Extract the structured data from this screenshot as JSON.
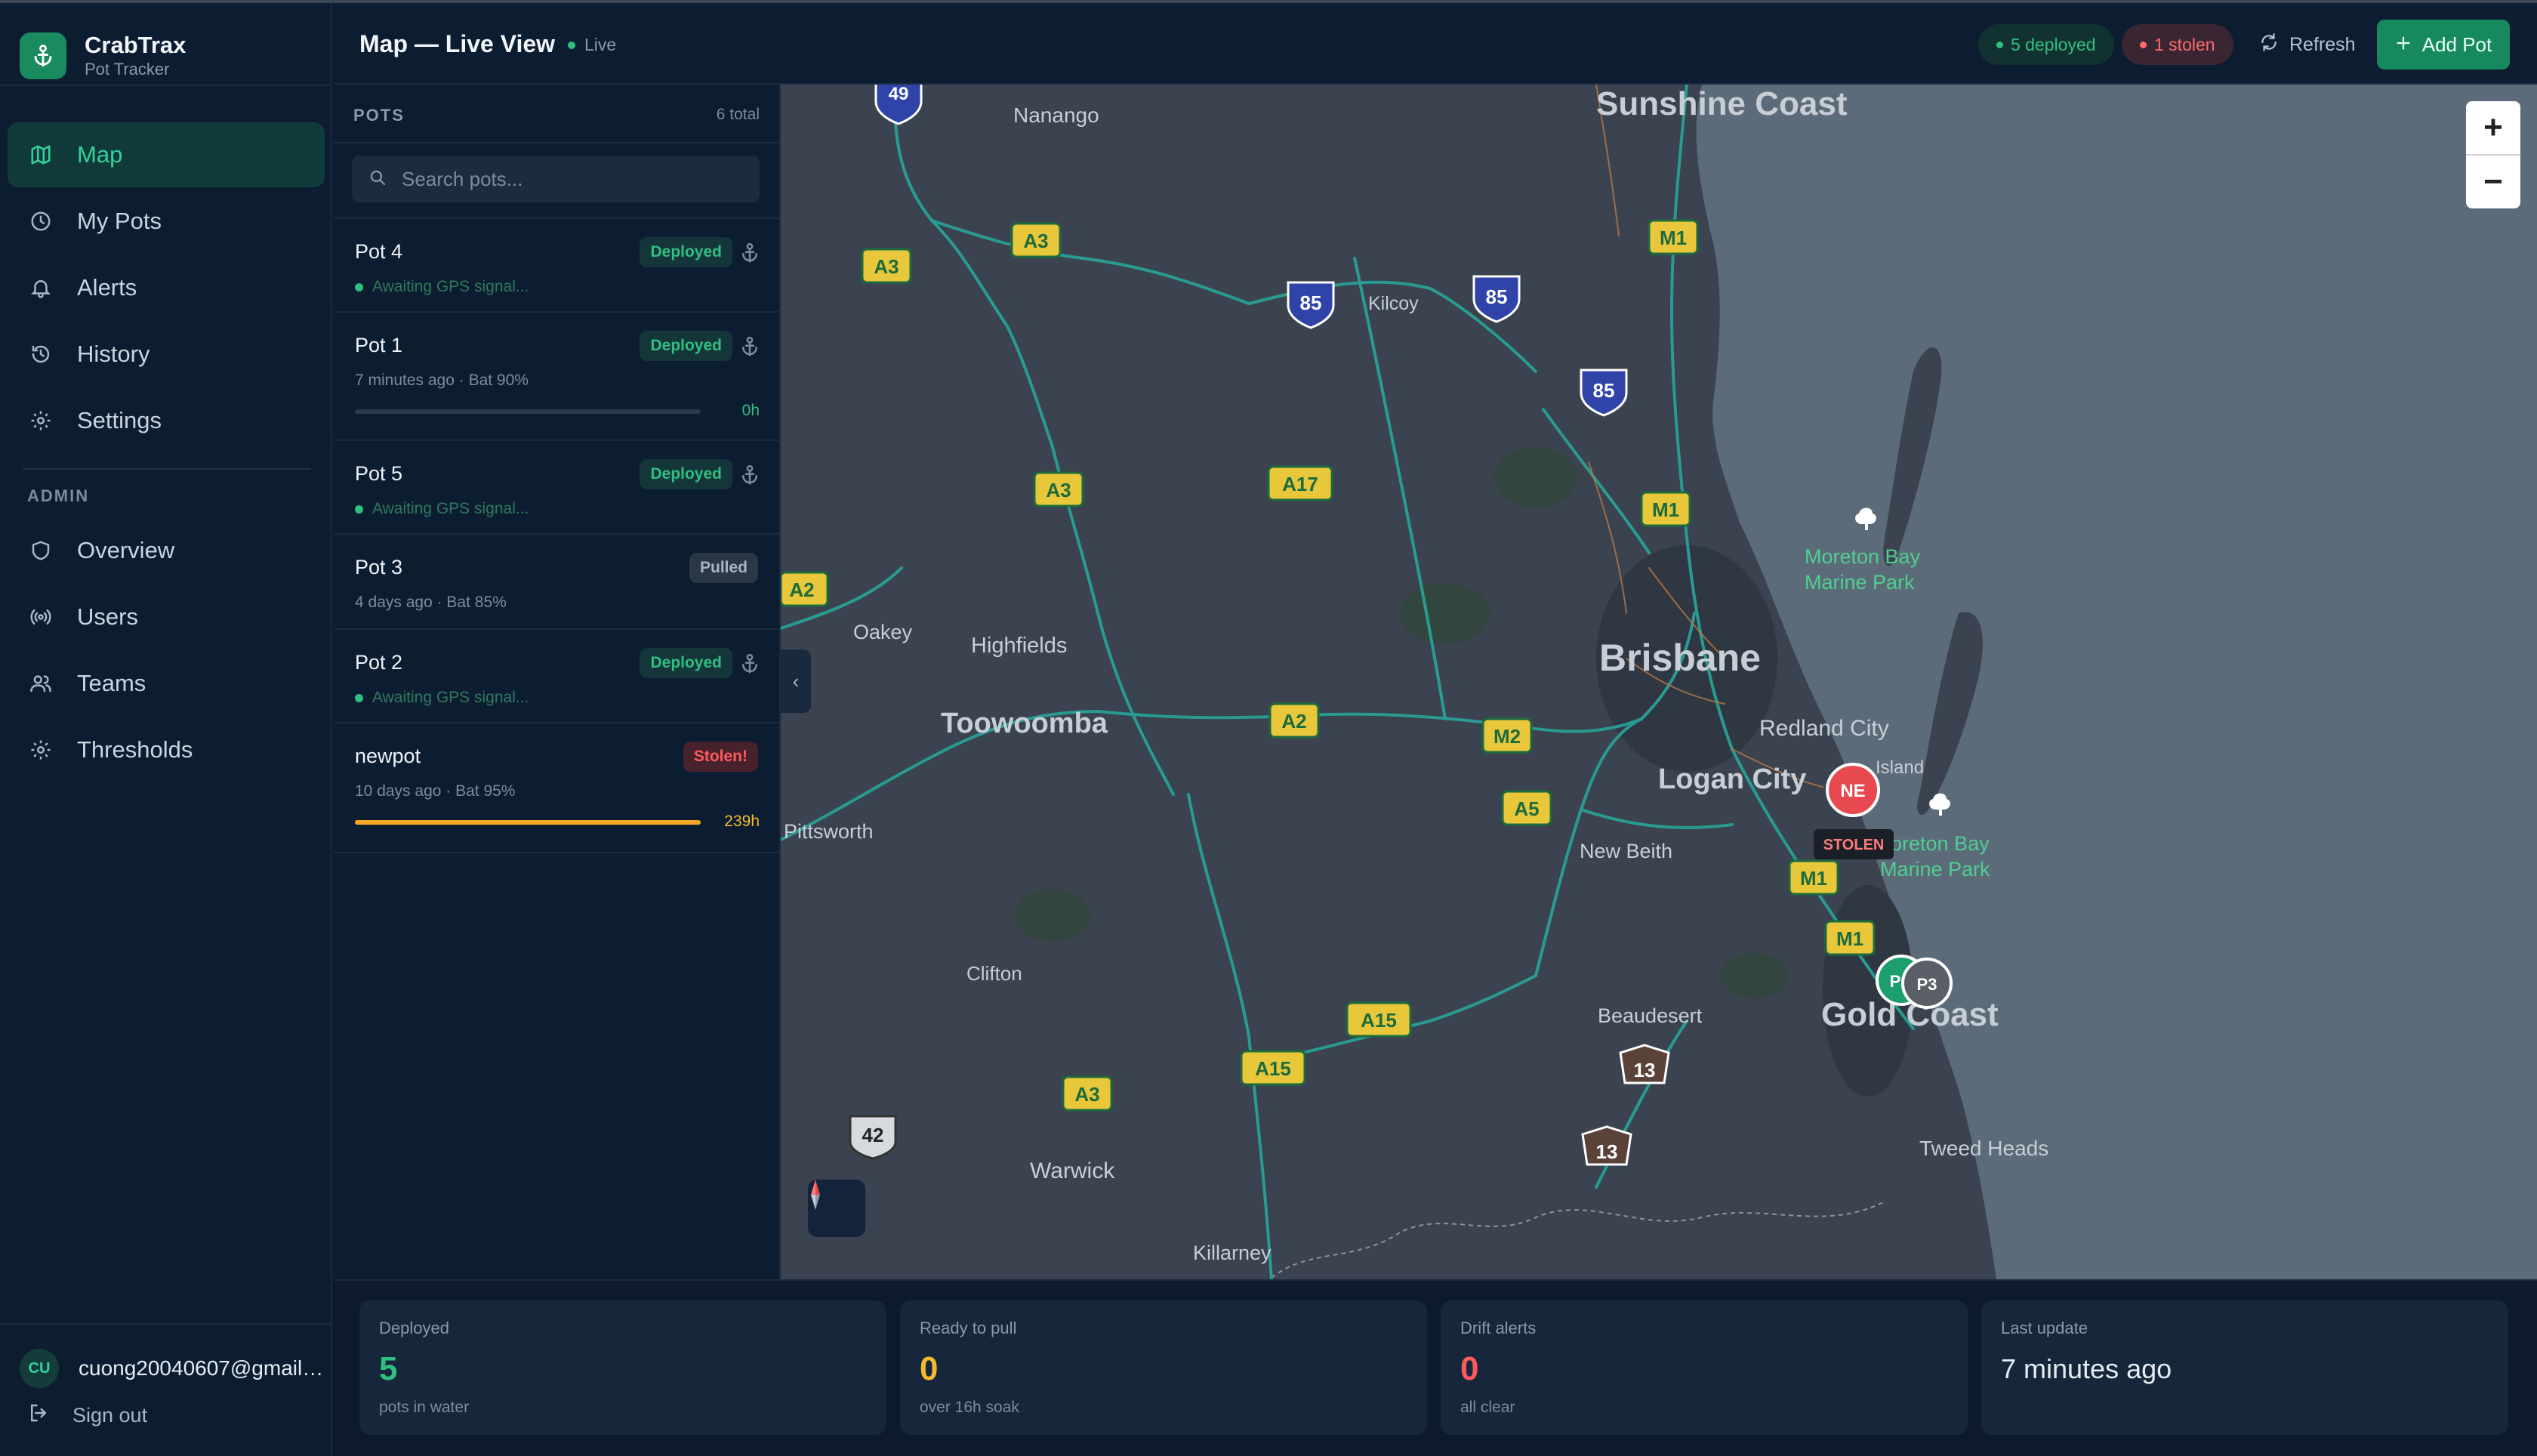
{
  "app": {
    "name": "CrabTrax",
    "subtitle": "Pot Tracker"
  },
  "sidebar": {
    "items": [
      {
        "label": "Map",
        "icon": "map-icon",
        "active": true
      },
      {
        "label": "My Pots",
        "icon": "clock-icon"
      },
      {
        "label": "Alerts",
        "icon": "bell-icon"
      },
      {
        "label": "History",
        "icon": "history-icon"
      },
      {
        "label": "Settings",
        "icon": "gear-icon"
      }
    ],
    "admin_heading": "ADMIN",
    "admin_items": [
      {
        "label": "Overview",
        "icon": "shield-icon"
      },
      {
        "label": "Users",
        "icon": "broadcast-icon"
      },
      {
        "label": "Teams",
        "icon": "users-icon"
      },
      {
        "label": "Thresholds",
        "icon": "gear-icon"
      }
    ],
    "user": {
      "initials": "CU",
      "email": "cuong20040607@gmail…"
    },
    "signout_label": "Sign out"
  },
  "header": {
    "title": "Map — Live View",
    "live_label": "Live",
    "deployed_pill": "5 deployed",
    "stolen_pill": "1 stolen",
    "refresh_label": "Refresh",
    "add_label": "Add Pot"
  },
  "pots": {
    "heading": "POTS",
    "count": "6 total",
    "search_placeholder": "Search pots...",
    "list": [
      {
        "name": "Pot 4",
        "badge": "Deployed",
        "sub": "Awaiting GPS signal..."
      },
      {
        "name": "Pot 1",
        "badge": "Deployed",
        "sub": "7 minutes ago · Bat 90%",
        "bar_value": "0h",
        "bar_fraction": 0
      },
      {
        "name": "Pot 5",
        "badge": "Deployed",
        "sub": "Awaiting GPS signal..."
      },
      {
        "name": "Pot 3",
        "badge": "Pulled",
        "sub": "4 days ago · Bat 85%"
      },
      {
        "name": "Pot 2",
        "badge": "Deployed",
        "sub": "Awaiting GPS signal..."
      },
      {
        "name": "newpot",
        "badge": "Stolen!",
        "sub": "10 days ago · Bat 95%",
        "bar_value": "239h",
        "bar_fraction": 1
      }
    ]
  },
  "map": {
    "places": {
      "sunshine_coast": "Sunshine Coast",
      "nanango": "Nanango",
      "kilcoy": "Kilcoy",
      "brisbane": "Brisbane",
      "redland_city": "Redland City",
      "logan_city": "Logan City",
      "new_beith": "New Beith",
      "gold_coast": "Gold Coast",
      "beaudesert": "Beaudesert",
      "tweed_heads": "Tweed Heads",
      "toowoomba": "Toowoomba",
      "highfields": "Highfields",
      "oakey": "Oakey",
      "pittsworth": "Pittsworth",
      "clifton": "Clifton",
      "warwick": "Warwick",
      "killarney": "Killarney",
      "island": "Island",
      "moreton_park_1a": "Moreton Bay",
      "moreton_park_1b": "Marine Park",
      "moreton_park_2a": "oreton Bay",
      "moreton_park_2b": "Marine Park"
    },
    "road_labels": {
      "r49": "49",
      "a3a": "A3",
      "a3b": "A3",
      "a3c": "A3",
      "a3d": "A3",
      "r85a": "85",
      "r85b": "85",
      "r85c": "85",
      "m1a": "M1",
      "m1b": "M1",
      "m1c": "M1",
      "m1d": "M1",
      "a17": "A17",
      "a2a": "A2",
      "a2b": "A2",
      "m2": "M2",
      "a5": "A5",
      "a15a": "A15",
      "a15b": "A15",
      "r13a": "13",
      "r13b": "13",
      "r42": "42"
    },
    "markers": {
      "ne": "NE",
      "stolen_tag": "STOLEN",
      "p": "P",
      "p3": "P3"
    },
    "zoom_in": "+",
    "zoom_out": "−",
    "collapse": "‹"
  },
  "stats": [
    {
      "label": "Deployed",
      "value": "5",
      "sub": "pots in water",
      "color": "#2fbf80"
    },
    {
      "label": "Ready to pull",
      "value": "0",
      "sub": "over 16h soak",
      "color": "#f5b92e"
    },
    {
      "label": "Drift alerts",
      "value": "0",
      "sub": "all clear",
      "color": "#ff5b5b"
    },
    {
      "label": "Last update",
      "value": "7 minutes ago",
      "sub": "",
      "color": "#e5ecf3"
    }
  ],
  "colors": {
    "accent": "#2fbf80",
    "danger": "#ff5b5b",
    "warning": "#f5b92e",
    "background": "#0c1a2c"
  }
}
